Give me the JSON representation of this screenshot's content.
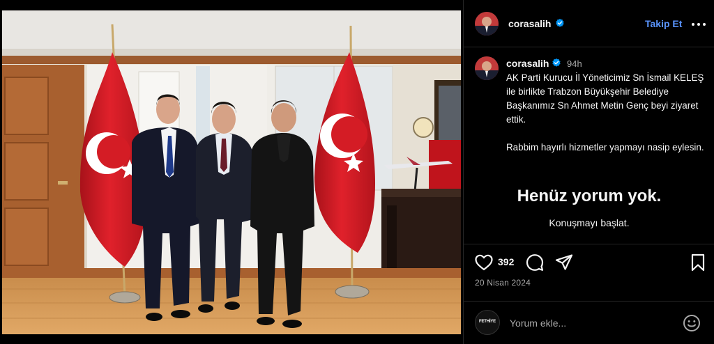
{
  "post": {
    "username": "corasalih",
    "follow_label": "Takip Et",
    "caption_time": "94h",
    "caption_paragraphs": [
      "AK Parti Kurucu İl Yöneticimiz Sn İsmail KELEŞ ile birlikte Trabzon Büyükşehir Belediye Başkanımız Sn Ahmet Metin Genç beyi ziyaret ettik.",
      "Rabbim hayırlı hizmetler yapmayı nasip eylesin."
    ],
    "no_comments_title": "Henüz yorum yok.",
    "start_conversation": "Konuşmayı başlat.",
    "like_count": "392",
    "date": "20 Nisan 2024",
    "comment_placeholder": "Yorum ekle...",
    "commenter_avatar_text": "FETHİYE"
  },
  "icons": {
    "verified": "verified-badge-icon",
    "more": "more-options-icon",
    "like": "heart-icon",
    "comment": "comment-bubble-icon",
    "share": "paper-plane-icon",
    "save": "bookmark-icon",
    "emoji": "smiley-icon"
  },
  "colors": {
    "background": "#000000",
    "accent": "#5a95ff",
    "verified": "#0095f6",
    "muted_text": "#a8a8a8",
    "divider": "#262626"
  }
}
